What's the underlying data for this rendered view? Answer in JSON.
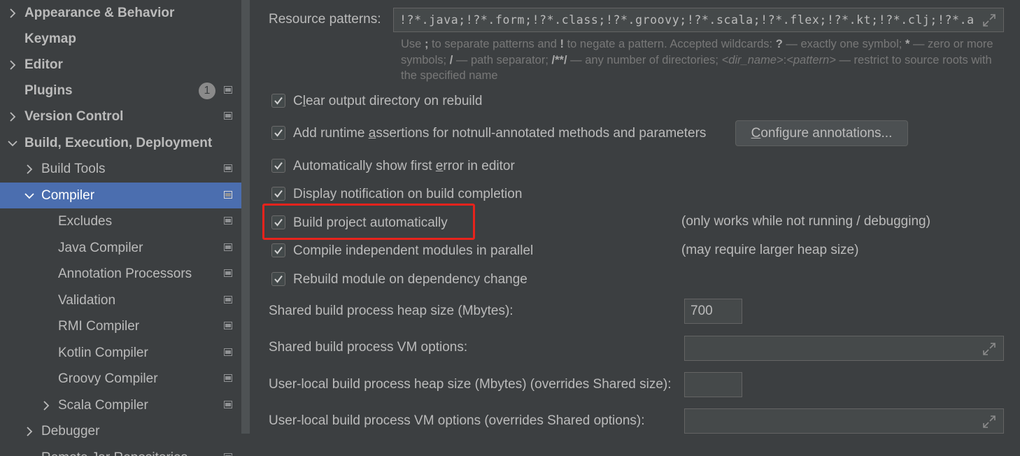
{
  "colors": {
    "background": "#3c3f41",
    "selection": "#4b6eaf",
    "highlight_box": "#e8231c",
    "text": "#bbbbbb",
    "hint_text": "#787878"
  },
  "sidebar": {
    "items": [
      {
        "label": "Appearance & Behavior",
        "arrow": "chevron-right-icon",
        "bold": true
      },
      {
        "label": "Keymap",
        "bold": true
      },
      {
        "label": "Editor",
        "arrow": "chevron-right-icon",
        "bold": true
      },
      {
        "label": "Plugins",
        "bold": true,
        "badge": "1"
      },
      {
        "label": "Version Control",
        "arrow": "chevron-right-icon",
        "bold": true
      },
      {
        "label": "Build, Execution, Deployment",
        "arrow": "chevron-down-icon",
        "bold": true
      },
      {
        "label": "Build Tools",
        "arrow": "chevron-right-icon"
      },
      {
        "label": "Compiler",
        "arrow": "chevron-down-icon",
        "selected": true
      },
      {
        "label": "Excludes"
      },
      {
        "label": "Java Compiler"
      },
      {
        "label": "Annotation Processors"
      },
      {
        "label": "Validation"
      },
      {
        "label": "RMI Compiler"
      },
      {
        "label": "Kotlin Compiler"
      },
      {
        "label": "Groovy Compiler"
      },
      {
        "label": "Scala Compiler",
        "arrow": "chevron-right-icon"
      },
      {
        "label": "Debugger",
        "arrow": "chevron-right-icon"
      },
      {
        "label": "Remote Jar Repositories"
      }
    ]
  },
  "main": {
    "resource_patterns": {
      "label": "Resource patterns:",
      "value": "!?*.java;!?*.form;!?*.class;!?*.groovy;!?*.scala;!?*.flex;!?*.kt;!?*.clj;!?*.aj",
      "hint": {
        "p1": "Use ",
        "semi": ";",
        "p2": " to separate patterns and ",
        "bang": "!",
        "p3": " to negate a pattern. Accepted wildcards: ",
        "q": "?",
        "p4": " — exactly one symbol; ",
        "star": "*",
        "p5": " — zero or more symbols; ",
        "slash": "/",
        "p6": " — path separator; ",
        "dstar": "/**/",
        "p7": " — any number of directories; ",
        "dirname": "<dir_name>",
        "colon": ":",
        "pattern": "<pattern>",
        "p8": " — restrict to source roots with the specified name"
      }
    },
    "checkboxes": {
      "clear_output": {
        "pre": "C",
        "mn": "l",
        "post": "ear output directory on rebuild",
        "checked": true
      },
      "runtime_assertions": {
        "pre": "Add runtime ",
        "mn": "a",
        "post": "ssertions for notnull-annotated methods and parameters",
        "checked": true
      },
      "show_first_error": {
        "pre": "Automatically show first ",
        "mn": "e",
        "post": "rror in editor",
        "checked": true
      },
      "notify_build": {
        "label": "Display notification on build completion",
        "checked": true
      },
      "build_auto": {
        "label": "Build project automatically",
        "checked": true
      },
      "parallel": {
        "label": "Compile independent modules in parallel",
        "checked": true
      },
      "rebuild_dep": {
        "label": "Rebuild module on dependency change",
        "checked": true
      }
    },
    "configure_button": {
      "mn": "C",
      "rest": "onfigure annotations..."
    },
    "notes": {
      "build_auto": "(only works while not running / debugging)",
      "parallel": "(may require larger heap size)"
    },
    "shared_heap": {
      "label": "Shared build process heap size (Mbytes):",
      "value": "700"
    },
    "shared_vm": {
      "label": "Shared build process VM options:",
      "value": ""
    },
    "local_heap": {
      "label": "User-local build process heap size (Mbytes) (overrides Shared size):",
      "value": ""
    },
    "local_vm": {
      "label": "User-local build process VM options (overrides Shared options):",
      "value": ""
    }
  }
}
